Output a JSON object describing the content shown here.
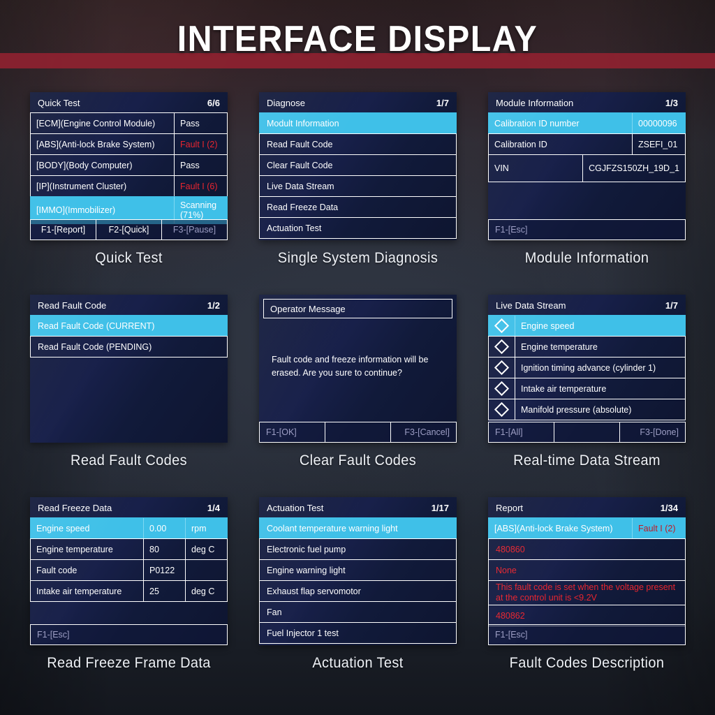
{
  "header": {
    "title": "INTERFACE DISPLAY",
    "band_color": "#8e2230"
  },
  "theme": {
    "screen_bg": "#141c3c",
    "highlight": "#3fc0e8",
    "fault_red": "#e8252f",
    "dim_text": "#9d9ec4",
    "text": "#ffffff"
  },
  "cards": [
    {
      "caption": "Quick Test",
      "screen": {
        "title": "Quick Test",
        "pager": "6/6",
        "rows": [
          {
            "label": "[ECM](Engine Control Module)",
            "value": "Pass",
            "selected": false,
            "fault": false
          },
          {
            "label": "[ABS](Anti-lock Brake System)",
            "value": "Fault  I  (2)",
            "selected": false,
            "fault": true
          },
          {
            "label": "[BODY](Body Computer)",
            "value": "Pass",
            "selected": false,
            "fault": false
          },
          {
            "label": "[IP](Instrument Cluster)",
            "value": "Fault  I  (6)",
            "selected": false,
            "fault": true
          },
          {
            "label": "[IMMO](Immobilizer)",
            "value": "Scanning (71%)",
            "selected": true,
            "fault": false
          }
        ],
        "buttons": [
          {
            "label": "F1-[Report]",
            "disabled": false
          },
          {
            "label": "F2-[Quick]",
            "disabled": false
          },
          {
            "label": "F3-[Pause]",
            "disabled": true
          }
        ]
      }
    },
    {
      "caption": "Single System Diagnosis",
      "screen": {
        "title": "Diagnose",
        "pager": "1/7",
        "rows": [
          {
            "label": "Modult Information",
            "selected": true
          },
          {
            "label": "Read Fault Code",
            "selected": false
          },
          {
            "label": "Clear Fault Code",
            "selected": false
          },
          {
            "label": "Live Data Stream",
            "selected": false
          },
          {
            "label": "Read Freeze Data",
            "selected": false
          },
          {
            "label": "Actuation Test",
            "selected": false
          }
        ]
      }
    },
    {
      "caption": "Module Information",
      "screen": {
        "title": "Module Information",
        "pager": "1/3",
        "rows": [
          {
            "label": "Calibration ID number",
            "value": "00000096",
            "selected": true
          },
          {
            "label": "Calibration ID",
            "value": "ZSEFI_01",
            "selected": false
          },
          {
            "label": "VIN",
            "value": "CGJFZS150ZH_19D_1",
            "selected": false
          }
        ],
        "buttons": [
          {
            "label": "F1-[Esc]",
            "disabled": true
          }
        ]
      }
    },
    {
      "caption": "Read Fault Codes",
      "screen": {
        "title": "Read Fault Code",
        "pager": "1/2",
        "rows": [
          {
            "label": "Read Fault Code     (CURRENT)",
            "selected": true
          },
          {
            "label": "Read Fault Code     (PENDING)",
            "selected": false
          }
        ]
      }
    },
    {
      "caption": "Clear Fault Codes",
      "screen": {
        "title": "Operator Message",
        "message": "Fault code and freeze information will be erased. Are you sure to continue?",
        "buttons": [
          {
            "label": "F1-[OK]",
            "disabled": true
          },
          {
            "label": "",
            "disabled": true
          },
          {
            "label": "F3-[Cancel]",
            "disabled": true
          }
        ]
      }
    },
    {
      "caption": "Real-time Data Stream",
      "screen": {
        "title": "Live Data Stream",
        "pager": "1/7",
        "rows": [
          {
            "label": "Engine speed",
            "selected": true,
            "checkbox": "diamond-unchecked"
          },
          {
            "label": "Engine temperature",
            "selected": false,
            "checkbox": "diamond-unchecked"
          },
          {
            "label": "Ignition timing advance (cylinder 1)",
            "selected": false,
            "checkbox": "diamond-unchecked"
          },
          {
            "label": "Intake air temperature",
            "selected": false,
            "checkbox": "diamond-unchecked"
          },
          {
            "label": "Manifold pressure (absolute)",
            "selected": false,
            "checkbox": "diamond-unchecked"
          }
        ],
        "buttons": [
          {
            "label": "F1-[All]",
            "disabled": true
          },
          {
            "label": "",
            "disabled": true
          },
          {
            "label": "F3-[Done]",
            "disabled": true
          }
        ]
      }
    },
    {
      "caption": "Read Freeze Frame Data",
      "screen": {
        "title": "Read Freeze Data",
        "pager": "1/4",
        "rows": [
          {
            "label": "Engine speed",
            "value": "0.00",
            "unit": "rpm",
            "selected": true
          },
          {
            "label": "Engine temperature",
            "value": "80",
            "unit": "deg C",
            "selected": false
          },
          {
            "label": "Fault code",
            "value": "P0122",
            "unit": "",
            "selected": false
          },
          {
            "label": "Intake air temperature",
            "value": "25",
            "unit": "deg C",
            "selected": false
          }
        ],
        "buttons": [
          {
            "label": "F1-[Esc]",
            "disabled": true
          }
        ]
      }
    },
    {
      "caption": "Actuation Test",
      "screen": {
        "title": "Actuation Test",
        "pager": "1/17",
        "rows": [
          {
            "label": "Coolant temperature warning light",
            "selected": true
          },
          {
            "label": "Electronic fuel pump",
            "selected": false
          },
          {
            "label": "Engine warning light",
            "selected": false
          },
          {
            "label": "Exhaust flap servomotor",
            "selected": false
          },
          {
            "label": "Fan",
            "selected": false
          },
          {
            "label": "Fuel Injector 1 test",
            "selected": false
          }
        ]
      }
    },
    {
      "caption": "Fault Codes Description",
      "screen": {
        "title": "Report",
        "pager": "1/34",
        "rows": [
          {
            "label": "[ABS](Anti-lock Brake System)",
            "value": "Fault  I  (2)",
            "selected": true,
            "fault": true
          },
          {
            "label": "480860",
            "selected": false,
            "red": true
          },
          {
            "label": "None",
            "selected": false,
            "red": true
          },
          {
            "label": "This fault code is set when the voltage present at the control unit is <9.2V",
            "selected": false,
            "red": true,
            "two_line": true
          },
          {
            "label": "480862",
            "selected": false,
            "red": true
          }
        ],
        "buttons": [
          {
            "label": "F1-[Esc]",
            "disabled": true
          }
        ]
      }
    }
  ]
}
